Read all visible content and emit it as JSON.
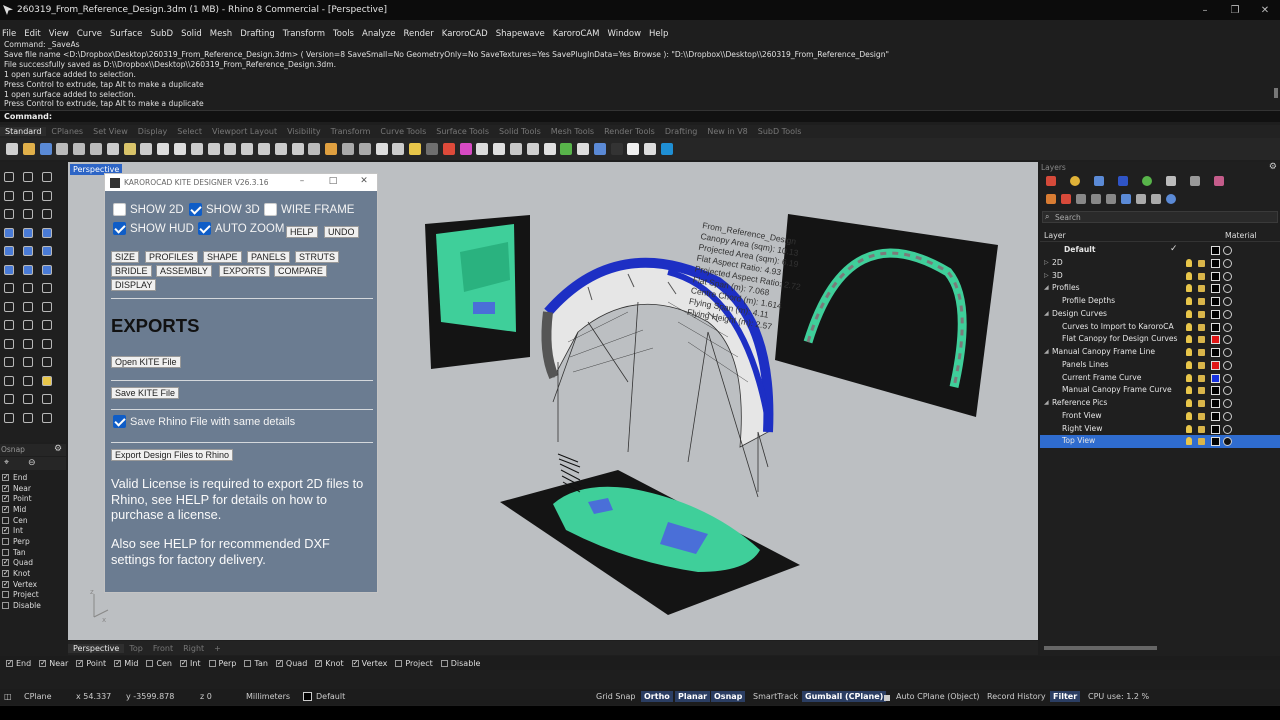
{
  "window": {
    "title": "260319_From_Reference_Design.3dm (1 MB) - Rhino 8 Commercial - [Perspective]",
    "controls": [
      "–",
      "❐",
      "✕"
    ]
  },
  "menu": [
    "File",
    "Edit",
    "View",
    "Curve",
    "Surface",
    "SubD",
    "Solid",
    "Mesh",
    "Drafting",
    "Transform",
    "Tools",
    "Analyze",
    "Render",
    "KaroroCAD",
    "Shapewave",
    "KaroroCAM",
    "Window",
    "Help"
  ],
  "command_history": [
    "Command: _SaveAs",
    "Save file name <D:\\Dropbox\\Desktop\\260319_From_Reference_Design.3dm> ( Version=8  SaveSmall=No  GeometryOnly=No  SaveTextures=Yes  SavePlugInData=Yes  Browse ): \"D:\\\\Dropbox\\\\Desktop\\\\260319_From_Reference_Design\"",
    "File successfully saved as D:\\\\Dropbox\\\\Desktop\\\\260319_From_Reference_Design.3dm.",
    "1 open surface added to selection.",
    "Press Control to extrude, tap Alt to make a duplicate",
    "1 open surface added to selection.",
    "Press Control to extrude, tap Alt to make a duplicate"
  ],
  "command_prompt": "Command:",
  "toolbar_tabs": [
    "Standard",
    "CPlanes",
    "Set View",
    "Display",
    "Select",
    "Viewport Layout",
    "Visibility",
    "Transform",
    "Curve Tools",
    "Surface Tools",
    "Solid Tools",
    "Mesh Tools",
    "Render Tools",
    "Drafting",
    "New in V8",
    "SubD Tools"
  ],
  "active_toolbar_tab": "Standard",
  "viewport": {
    "label": "Perspective",
    "tabs": [
      "Perspective",
      "Top",
      "Front",
      "Right",
      "+"
    ],
    "active_tab": "Perspective",
    "kite_info_lines": [
      "From_Reference_Design",
      "Canopy Area (sqm): 10.13",
      "Projected Area (sqm): 6.19",
      "Flat Aspect Ratio: 4.93",
      "Projected Aspect Ratio: 2.72",
      "Flat Span (m): 7.068",
      "Centre Chord (m): 1.614",
      "Flying Span (m): 4.11",
      "Flying Height (m): 2.57"
    ]
  },
  "kite_designer": {
    "title": "KAROROCAD KITE DESIGNER V26.3.16",
    "checks": [
      {
        "label": "SHOW 2D",
        "checked": false
      },
      {
        "label": "SHOW 3D",
        "checked": true
      },
      {
        "label": "WIRE FRAME",
        "checked": false
      },
      {
        "label": "SHOW HUD",
        "checked": true
      },
      {
        "label": "AUTO ZOOM",
        "checked": true
      }
    ],
    "help_label": "HELP",
    "undo_label": "UNDO",
    "nav_buttons": [
      "SIZE",
      "PROFILES",
      "SHAPE",
      "PANELS",
      "STRUTS",
      "BRIDLE",
      "ASSEMBLY",
      "EXPORTS",
      "COMPARE",
      "DISPLAY"
    ],
    "section_title": "EXPORTS",
    "open_kite_label": "Open KITE File",
    "save_kite_label": "Save KITE File",
    "save_rhino_label": "Save Rhino File with same details",
    "save_rhino_checked": true,
    "export_design_label": "Export Design Files to Rhino",
    "license_note": "Valid License is required to export 2D files to Rhino, see HELP for details on how to purchase a license.",
    "dxf_note": "Also see HELP for recommended DXF settings for factory delivery."
  },
  "osnap_panel": {
    "title": "Osnap",
    "items": [
      {
        "label": "End",
        "checked": true
      },
      {
        "label": "Near",
        "checked": true
      },
      {
        "label": "Point",
        "checked": true
      },
      {
        "label": "Mid",
        "checked": true
      },
      {
        "label": "Cen",
        "checked": false
      },
      {
        "label": "Int",
        "checked": true
      },
      {
        "label": "Perp",
        "checked": false
      },
      {
        "label": "Tan",
        "checked": false
      },
      {
        "label": "Quad",
        "checked": true
      },
      {
        "label": "Knot",
        "checked": true
      },
      {
        "label": "Vertex",
        "checked": true
      },
      {
        "label": "Project",
        "checked": false
      },
      {
        "label": "Disable",
        "checked": false
      }
    ]
  },
  "layers_panel": {
    "title": "Layers",
    "search_placeholder": "Search",
    "col_layer": "Layer",
    "col_material": "Material",
    "rows": [
      {
        "name": "Default",
        "level": 0,
        "expander": "",
        "current": true,
        "color": "#000000",
        "selected": false
      },
      {
        "name": "2D",
        "level": 0,
        "expander": "▷",
        "current": false,
        "color": "#000000",
        "selected": false
      },
      {
        "name": "3D",
        "level": 0,
        "expander": "▷",
        "current": false,
        "color": "#000000",
        "selected": false
      },
      {
        "name": "Profiles",
        "level": 0,
        "expander": "◢",
        "current": false,
        "color": "#000000",
        "selected": false
      },
      {
        "name": "Profile Depths",
        "level": 1,
        "expander": "",
        "current": false,
        "color": "#000000",
        "selected": false
      },
      {
        "name": "Design Curves",
        "level": 0,
        "expander": "◢",
        "current": false,
        "color": "#000000",
        "selected": false
      },
      {
        "name": "Curves to Import to KaroroCA",
        "level": 1,
        "expander": "",
        "current": false,
        "color": "#000000",
        "selected": false
      },
      {
        "name": "Flat Canopy for Design Curves",
        "level": 1,
        "expander": "",
        "current": false,
        "color": "#e01515",
        "selected": false
      },
      {
        "name": "Manual Canopy Frame Line",
        "level": 0,
        "expander": "◢",
        "current": false,
        "color": "#000000",
        "selected": false
      },
      {
        "name": "Panels Lines",
        "level": 1,
        "expander": "",
        "current": false,
        "color": "#e01515",
        "selected": false
      },
      {
        "name": "Current Frame Curve",
        "level": 1,
        "expander": "",
        "current": false,
        "color": "#1530e0",
        "selected": false
      },
      {
        "name": "Manual Canopy Frame Curve",
        "level": 1,
        "expander": "",
        "current": false,
        "color": "#000000",
        "selected": false
      },
      {
        "name": "Reference Pics",
        "level": 0,
        "expander": "◢",
        "current": false,
        "color": "#000000",
        "selected": false
      },
      {
        "name": "Front View",
        "level": 1,
        "expander": "",
        "current": false,
        "color": "#000000",
        "selected": false
      },
      {
        "name": "Right View",
        "level": 1,
        "expander": "",
        "current": false,
        "color": "#000000",
        "selected": false
      },
      {
        "name": "Top View",
        "level": 1,
        "expander": "",
        "current": false,
        "color": "#000000",
        "selected": true
      }
    ]
  },
  "status_bar": {
    "cplane": "CPlane",
    "x": "x 54.337",
    "y": "y -3599.878",
    "z": "z 0",
    "units": "Millimeters",
    "layer": "Default",
    "grid_snap": "Grid Snap",
    "ortho": "Ortho",
    "planar": "Planar",
    "osnap": "Osnap",
    "smarttrack": "SmartTrack",
    "gumball": "Gumball (CPlane)",
    "auto_cplane": "Auto CPlane (Object)",
    "record_history": "Record History",
    "filter": "Filter",
    "cpu": "CPU use: 1.2 %"
  },
  "colors": {
    "accent_blue": "#2d65c6",
    "dialog_bg": "#6b7c91",
    "kite_canopy": "#e6e6e6",
    "kite_le": "#1d2fc4",
    "reference_green": "#3fcf9a"
  }
}
